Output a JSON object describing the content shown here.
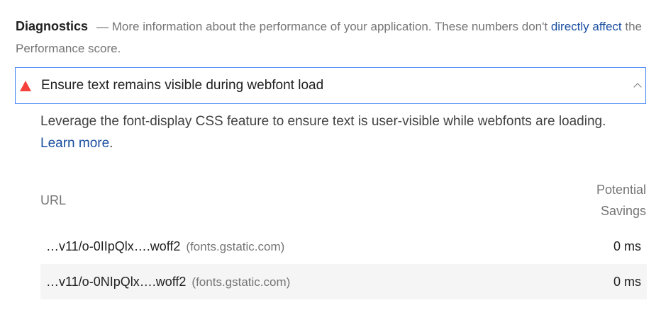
{
  "section": {
    "title": "Diagnostics",
    "description_prefix": "— More information about the performance of your application. These numbers don't ",
    "description_link": "directly affect",
    "description_suffix": " the Performance score."
  },
  "audit": {
    "title": "Ensure text remains visible during webfont load",
    "description": "Leverage the font-display CSS feature to ensure text is user-visible while webfonts are loading.",
    "learn_more": "Learn more",
    "learn_more_suffix": ".",
    "status_color": "#f4413b"
  },
  "table": {
    "headers": {
      "url": "URL",
      "savings_line1": "Potential",
      "savings_line2": "Savings"
    },
    "rows": [
      {
        "url": "…v11/o-0IIpQlx….woff2",
        "host": "(fonts.gstatic.com)",
        "savings": "0 ms"
      },
      {
        "url": "…v11/o-0NIpQlx….woff2",
        "host": "(fonts.gstatic.com)",
        "savings": "0 ms"
      }
    ]
  }
}
